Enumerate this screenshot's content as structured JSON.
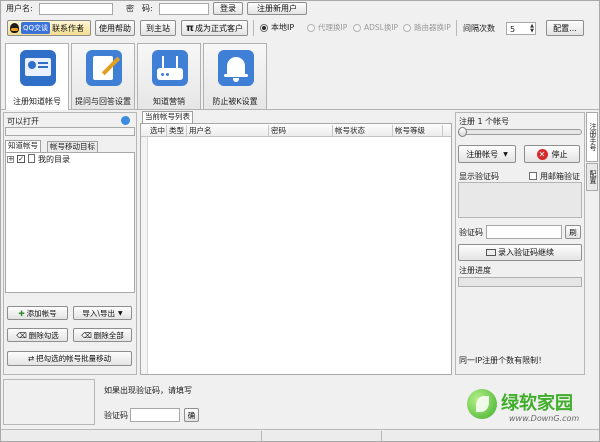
{
  "topbar": {
    "username_label": "用户名:",
    "password_label": "密　码:",
    "login_button": "登录",
    "register_button": "注册新用户",
    "qq_button": "QQ交谈",
    "contact_button": "联系作者",
    "help_button": "使用帮助",
    "site_button": "到主站",
    "official_button": "成为正式客户",
    "ip_options": [
      {
        "label": "本地IP",
        "selected": true,
        "enabled": true
      },
      {
        "label": "代理换IP",
        "selected": false,
        "enabled": false
      },
      {
        "label": "ADSL换IP",
        "selected": false,
        "enabled": false
      },
      {
        "label": "路由器换IP",
        "selected": false,
        "enabled": false
      }
    ],
    "interval_label": "间隔次数",
    "interval_value": "5",
    "config_button": "配置..."
  },
  "tabs": [
    {
      "label": "注册知道帐号",
      "active": true,
      "icon": "account-card-icon"
    },
    {
      "label": "提问与回答设置",
      "active": false,
      "icon": "note-pencil-icon"
    },
    {
      "label": "知道营销",
      "active": false,
      "icon": "router-icon"
    },
    {
      "label": "防止被K设置",
      "active": false,
      "icon": "bell-icon"
    }
  ],
  "left_panel": {
    "title": "可以打开",
    "subtabs": [
      "知道帐号",
      "帐号移动目标"
    ],
    "tree_root": "我的目录",
    "buttons": {
      "add_account": "添加帐号",
      "import_export": "导入\\导出",
      "delete_checked": "删除勾选",
      "delete_all": "删除全部",
      "batch_move": "把勾选的帐号批量移动"
    }
  },
  "middle_panel": {
    "tab_label": "当前帐号列表",
    "columns": [
      "选中",
      "类型",
      "用户名",
      "密码",
      "帐号状态",
      "帐号等级"
    ]
  },
  "right_panel": {
    "title": "注册 1 个帐号",
    "register_button": "注册帐号",
    "stop_button": "停止",
    "show_captcha_label": "显示验证码",
    "email_verify_label": "用邮箱验证",
    "captcha_label": "验证码",
    "refresh_button": "刷",
    "submit_captcha_button": "录入验证码继续",
    "progress_label": "注册进度",
    "progress_value": 0,
    "footer_note": "同一IP注册个数有限制！",
    "side_tabs": [
      "注册手号",
      "配置"
    ]
  },
  "bottom": {
    "notice": "如果出现验证码，请填写",
    "captcha_label": "验证码",
    "confirm_button": "确"
  },
  "watermark": {
    "brand": "绿软家园",
    "url": "www.DownG.com"
  },
  "colors": {
    "accent_blue": "#2f6fc8",
    "stop_red": "#d42a2a",
    "brand_green": "#3fae2a"
  }
}
